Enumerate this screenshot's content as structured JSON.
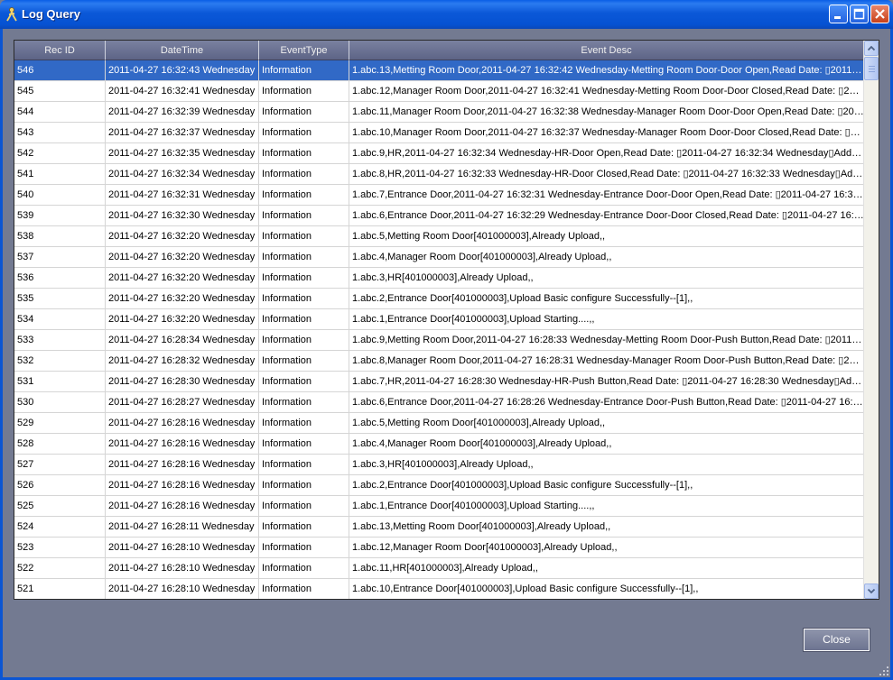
{
  "window": {
    "title": "Log Query",
    "accent": "#0b55d3"
  },
  "list": {
    "columns": [
      "Rec ID",
      "DateTime",
      "EventType",
      "Event Desc"
    ],
    "selected_index": 0,
    "rows": [
      [
        "546",
        "2011-04-27 16:32:43 Wednesday",
        "Information",
        "1.abc.13,Metting Room Door,2011-04-27 16:32:42 Wednesday-Metting Room Door-Door Open,Read Date: ▯2011-04..."
      ],
      [
        "545",
        "2011-04-27 16:32:41 Wednesday",
        "Information",
        "1.abc.12,Manager Room Door,2011-04-27 16:32:41 Wednesday-Metting Room Door-Door Closed,Read Date: ▯2011-0..."
      ],
      [
        "544",
        "2011-04-27 16:32:39 Wednesday",
        "Information",
        "1.abc.11,Manager Room Door,2011-04-27 16:32:38 Wednesday-Manager Room Door-Door Open,Read Date: ▯2011..."
      ],
      [
        "543",
        "2011-04-27 16:32:37 Wednesday",
        "Information",
        "1.abc.10,Manager Room Door,2011-04-27 16:32:37 Wednesday-Manager Room Door-Door Closed,Read Date: ▯201..."
      ],
      [
        "542",
        "2011-04-27 16:32:35 Wednesday",
        "Information",
        "1.abc.9,HR,2011-04-27 16:32:34 Wednesday-HR-Door Open,Read Date: ▯2011-04-27 16:32:34 Wednesday▯Addr: ▯..."
      ],
      [
        "541",
        "2011-04-27 16:32:34 Wednesday",
        "Information",
        "1.abc.8,HR,2011-04-27 16:32:33 Wednesday-HR-Door Closed,Read Date: ▯2011-04-27 16:32:33 Wednesday▯Addr:..."
      ],
      [
        "540",
        "2011-04-27 16:32:31 Wednesday",
        "Information",
        "1.abc.7,Entrance Door,2011-04-27 16:32:31 Wednesday-Entrance Door-Door Open,Read Date: ▯2011-04-27 16:32:..."
      ],
      [
        "539",
        "2011-04-27 16:32:30 Wednesday",
        "Information",
        "1.abc.6,Entrance Door,2011-04-27 16:32:29 Wednesday-Entrance Door-Door Closed,Read Date: ▯2011-04-27 16:32..."
      ],
      [
        "538",
        "2011-04-27 16:32:20 Wednesday",
        "Information",
        "1.abc.5,Metting Room Door[401000003],Already Upload,,"
      ],
      [
        "537",
        "2011-04-27 16:32:20 Wednesday",
        "Information",
        "1.abc.4,Manager Room Door[401000003],Already Upload,,"
      ],
      [
        "536",
        "2011-04-27 16:32:20 Wednesday",
        "Information",
        "1.abc.3,HR[401000003],Already Upload,,"
      ],
      [
        "535",
        "2011-04-27 16:32:20 Wednesday",
        "Information",
        "1.abc.2,Entrance Door[401000003],Upload Basic configure Successfully--[1],,"
      ],
      [
        "534",
        "2011-04-27 16:32:20 Wednesday",
        "Information",
        "1.abc.1,Entrance Door[401000003],Upload Starting....,,"
      ],
      [
        "533",
        "2011-04-27 16:28:34 Wednesday",
        "Information",
        "1.abc.9,Metting Room Door,2011-04-27 16:28:33 Wednesday-Metting Room Door-Push Button,Read Date: ▯2011-04..."
      ],
      [
        "532",
        "2011-04-27 16:28:32 Wednesday",
        "Information",
        "1.abc.8,Manager Room Door,2011-04-27 16:28:31 Wednesday-Manager Room Door-Push Button,Read Date: ▯2011..."
      ],
      [
        "531",
        "2011-04-27 16:28:30 Wednesday",
        "Information",
        "1.abc.7,HR,2011-04-27 16:28:30 Wednesday-HR-Push Button,Read Date: ▯2011-04-27 16:28:30 Wednesday▯Addr:..."
      ],
      [
        "530",
        "2011-04-27 16:28:27 Wednesday",
        "Information",
        "1.abc.6,Entrance Door,2011-04-27 16:28:26 Wednesday-Entrance Door-Push Button,Read Date: ▯2011-04-27 16:28..."
      ],
      [
        "529",
        "2011-04-27 16:28:16 Wednesday",
        "Information",
        "1.abc.5,Metting Room Door[401000003],Already Upload,,"
      ],
      [
        "528",
        "2011-04-27 16:28:16 Wednesday",
        "Information",
        "1.abc.4,Manager Room Door[401000003],Already Upload,,"
      ],
      [
        "527",
        "2011-04-27 16:28:16 Wednesday",
        "Information",
        "1.abc.3,HR[401000003],Already Upload,,"
      ],
      [
        "526",
        "2011-04-27 16:28:16 Wednesday",
        "Information",
        "1.abc.2,Entrance Door[401000003],Upload Basic configure Successfully--[1],,"
      ],
      [
        "525",
        "2011-04-27 16:28:16 Wednesday",
        "Information",
        "1.abc.1,Entrance Door[401000003],Upload Starting....,,"
      ],
      [
        "524",
        "2011-04-27 16:28:11 Wednesday",
        "Information",
        "1.abc.13,Metting Room Door[401000003],Already Upload,,"
      ],
      [
        "523",
        "2011-04-27 16:28:10 Wednesday",
        "Information",
        "1.abc.12,Manager Room Door[401000003],Already Upload,,"
      ],
      [
        "522",
        "2011-04-27 16:28:10 Wednesday",
        "Information",
        "1.abc.11,HR[401000003],Already Upload,,"
      ],
      [
        "521",
        "2011-04-27 16:28:10 Wednesday",
        "Information",
        "1.abc.10,Entrance Door[401000003],Upload Basic configure Successfully--[1],,"
      ]
    ]
  },
  "footer": {
    "close_label": "Close"
  }
}
